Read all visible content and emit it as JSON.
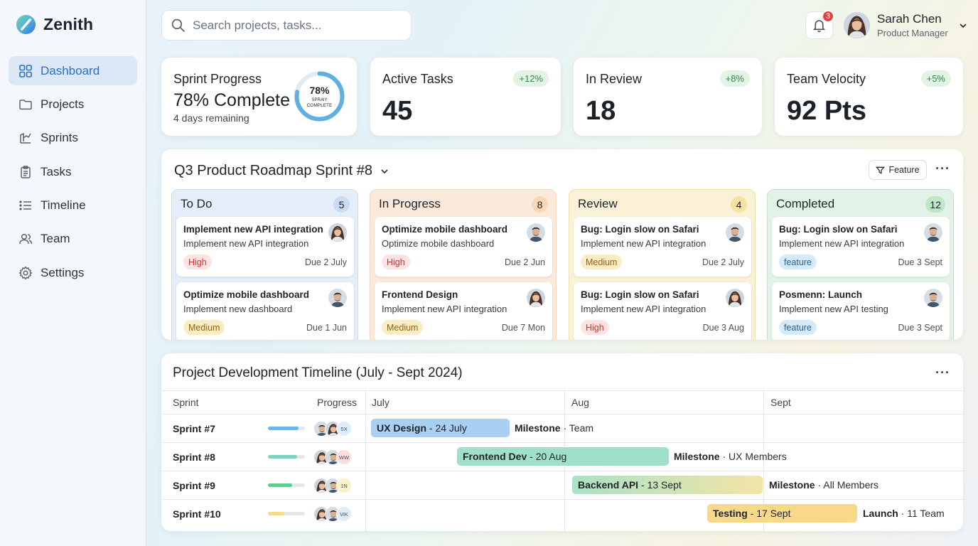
{
  "brand": {
    "name": "Zenith"
  },
  "sidebar": {
    "items": [
      {
        "label": "Dashboard",
        "icon": "grid-icon",
        "active": true
      },
      {
        "label": "Projects",
        "icon": "folder-icon"
      },
      {
        "label": "Sprints",
        "icon": "sprint-icon"
      },
      {
        "label": "Tasks",
        "icon": "clipboard-icon"
      },
      {
        "label": "Timeline",
        "icon": "list-icon"
      },
      {
        "label": "Team",
        "icon": "users-icon"
      },
      {
        "label": "Settings",
        "icon": "gear-icon"
      }
    ]
  },
  "header": {
    "search_placeholder": "Search projects, tasks...",
    "notification_count": "3",
    "user_name": "Sarah Chen",
    "user_role": "Product Manager"
  },
  "stats": {
    "sprint": {
      "title": "Sprint Progress",
      "value": "78% Complete",
      "sub": "4 days remaining",
      "ring_pct_label": "78%",
      "ring_caption_1": "SPRAIY",
      "ring_caption_2": "COMPLETE",
      "percent": 78
    },
    "active": {
      "title": "Active Tasks",
      "value": "45",
      "delta": "+12%"
    },
    "review": {
      "title": "In Review",
      "value": "18",
      "delta": "+8%"
    },
    "velocity": {
      "title": "Team Velocity",
      "value": "92 Pts",
      "delta": "+5%"
    }
  },
  "board": {
    "title": "Q3 Product Roadmap Sprint #8",
    "filter_label": "Feature",
    "columns": [
      {
        "name": "To Do",
        "count": "5",
        "tasks": [
          {
            "title": "Implement new API integration",
            "desc": "Implement new API integration",
            "tag": "High",
            "due": "Due 2 July"
          },
          {
            "title": "Optimize mobile dashboard",
            "desc": "Implement new dashboard",
            "tag": "Medium",
            "due": "Due 1 Jun"
          }
        ]
      },
      {
        "name": "In Progress",
        "count": "8",
        "tasks": [
          {
            "title": "Optimize mobile dashboard",
            "desc": "Optimize mobile dashboard",
            "tag": "High",
            "due": "Due 2 Jun"
          },
          {
            "title": "Frontend Design",
            "desc": "Implement new API integration",
            "tag": "Medium",
            "due": "Due 7 Mon"
          }
        ]
      },
      {
        "name": "Review",
        "count": "4",
        "tasks": [
          {
            "title": "Bug: Login slow on Safari",
            "desc": "Implement new API integration",
            "tag": "Medium",
            "due": "Due 2 July"
          },
          {
            "title": "Bug: Login slow on Safari",
            "desc": "Implement new API integration",
            "tag": "High",
            "due": "Due 3 Aug"
          }
        ]
      },
      {
        "name": "Completed",
        "count": "12",
        "tasks": [
          {
            "title": "Bug: Login slow on Safari",
            "desc": "Implement new API integration",
            "tag": "feature",
            "due": "Due 3 Sept"
          },
          {
            "title": "Posmenn: Launch",
            "desc": "Implement new API testing",
            "tag": "feature",
            "due": "Due 3 Sept"
          }
        ]
      }
    ]
  },
  "timeline": {
    "title": "Project Development Timeline (July - Sept 2024)",
    "headers": {
      "sprint": "Sprint",
      "progress": "Progress",
      "july": "July",
      "aug": "Aug",
      "sept": "Sept"
    },
    "rows": [
      {
        "sprint": "Sprint #7",
        "progress": 0.82,
        "more": "5X",
        "bar_name": "UX Design",
        "bar_date": "24 July",
        "milestone": "Milestone",
        "milestone_detail": "Team"
      },
      {
        "sprint": "Sprint #8",
        "progress": 0.78,
        "more": "WW",
        "bar_name": "Frontend Dev",
        "bar_date": "20 Aug",
        "milestone": "Milestone",
        "milestone_detail": "UX Members"
      },
      {
        "sprint": "Sprint #9",
        "progress": 0.65,
        "more": "1N",
        "bar_name": "Backend API",
        "bar_date": "13 Sept",
        "milestone": "Milestone",
        "milestone_detail": "All Members"
      },
      {
        "sprint": "Sprint #10",
        "progress": 0.45,
        "more": "VIK",
        "bar_name": "Testing",
        "bar_date": "17 Sept",
        "milestone": "Launch",
        "milestone_detail": "11 Team"
      }
    ]
  },
  "colors": {
    "accent": "#2b6fc7",
    "high": "#c03a33",
    "medium": "#8f6512",
    "feature": "#285f8d",
    "positive": "#2e8a44"
  }
}
